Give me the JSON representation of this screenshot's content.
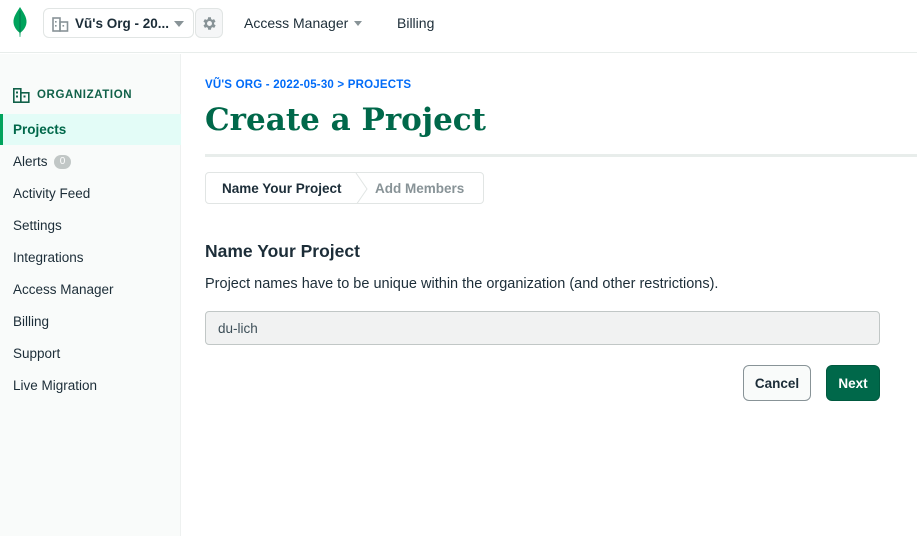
{
  "topbar": {
    "logo_icon": "mongodb-leaf-icon",
    "org_name": "Vũ's Org - 20...",
    "org_icon": "building-icon",
    "gear_icon": "gear-icon",
    "nav_access_manager": "Access Manager",
    "nav_billing": "Billing"
  },
  "sidebar": {
    "heading": "ORGANIZATION",
    "heading_icon": "building-icon",
    "items": [
      {
        "label": "Projects",
        "active": true
      },
      {
        "label": "Alerts",
        "badge": "0"
      },
      {
        "label": "Activity Feed"
      },
      {
        "label": "Settings"
      },
      {
        "label": "Integrations"
      },
      {
        "label": "Access Manager"
      },
      {
        "label": "Billing"
      },
      {
        "label": "Support"
      },
      {
        "label": "Live Migration"
      }
    ]
  },
  "main": {
    "breadcrumb": "VŨ'S ORG - 2022-05-30 > PROJECTS",
    "title": "Create a Project",
    "steps": [
      "Name Your Project",
      "Add Members"
    ],
    "section_title": "Name Your Project",
    "section_desc": "Project names have to be unique within the organization (and other restrictions).",
    "project_name_value": "du-lich",
    "cancel_label": "Cancel",
    "next_label": "Next"
  },
  "colors": {
    "brand_green": "#00684a",
    "accent_green": "#00a35c",
    "link_blue": "#016bf8",
    "active_bg": "#e3fcf7"
  }
}
